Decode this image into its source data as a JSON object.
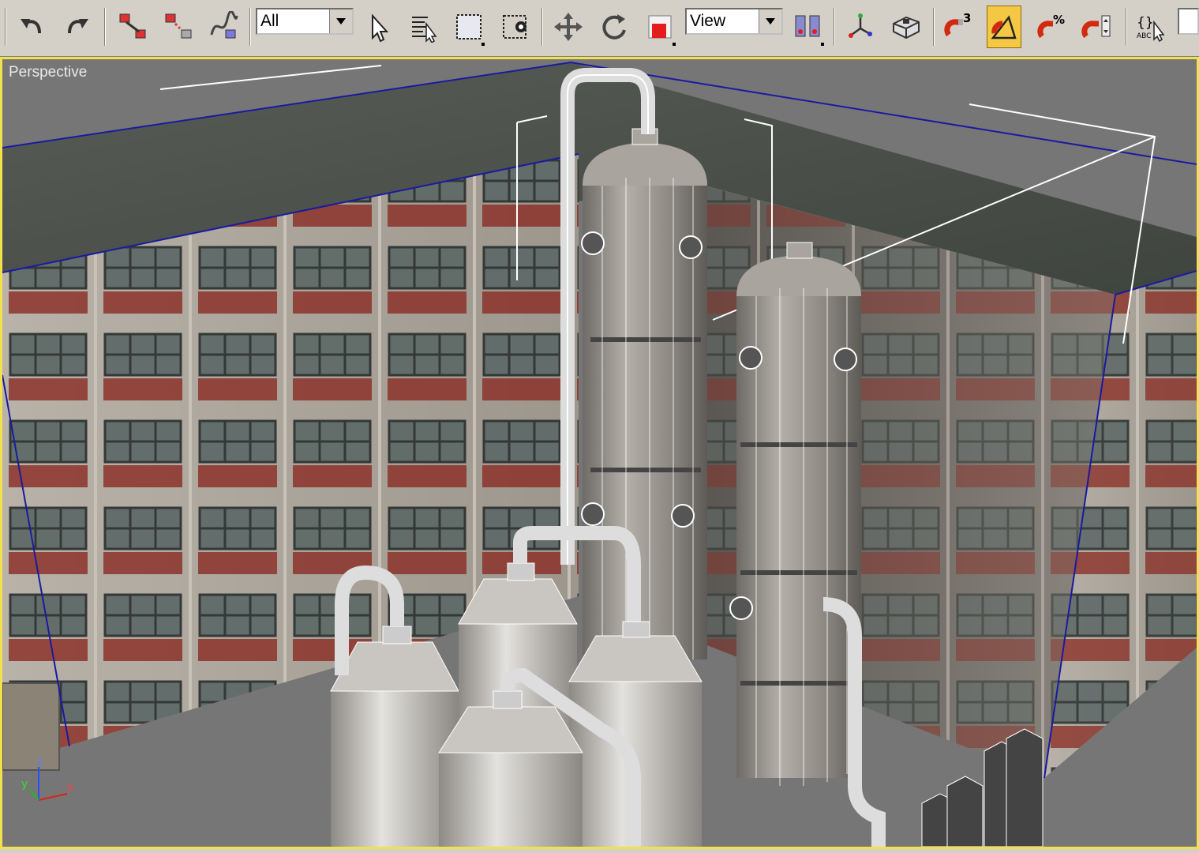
{
  "toolbar": {
    "selection_filter": {
      "value": "All"
    },
    "coord_system": {
      "value": "View"
    },
    "buttons": [
      {
        "name": "undo-icon"
      },
      {
        "name": "redo-icon"
      },
      {
        "name": "select-and-link-icon"
      },
      {
        "name": "unlink-selection-icon"
      },
      {
        "name": "bind-to-space-warp-icon"
      },
      {
        "name": "select-object-icon"
      },
      {
        "name": "select-by-name-icon"
      },
      {
        "name": "rectangular-selection-region-icon"
      },
      {
        "name": "window-crossing-toggle-icon"
      },
      {
        "name": "select-and-move-icon"
      },
      {
        "name": "select-and-rotate-icon"
      },
      {
        "name": "select-and-scale-icon"
      },
      {
        "name": "use-pivot-point-center-icon"
      },
      {
        "name": "select-and-manipulate-icon"
      },
      {
        "name": "keyboard-shortcut-override-icon"
      },
      {
        "name": "snaps-toggle-icon",
        "badge": "3"
      },
      {
        "name": "angle-snap-toggle-icon",
        "active": true
      },
      {
        "name": "percent-snap-toggle-icon",
        "badge": "%"
      },
      {
        "name": "spinner-snap-toggle-icon"
      },
      {
        "name": "edit-named-selection-sets-icon",
        "badge": "{}"
      }
    ]
  },
  "viewport": {
    "label": "Perspective",
    "border_color": "#f2e14a",
    "axis_labels": {
      "x": "x",
      "y": "y",
      "z": "z"
    }
  },
  "colors": {
    "toolbar_bg": "#d4d0c8",
    "active_button": "#f5c843",
    "viewport_border": "#f2e14a",
    "bounding_box": "#1a1aa0"
  }
}
